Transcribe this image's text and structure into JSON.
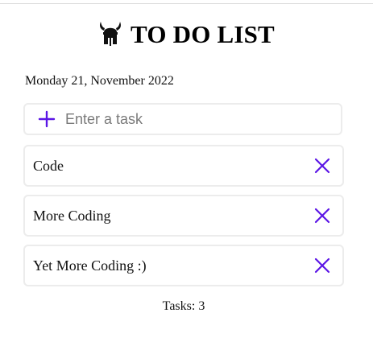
{
  "header": {
    "title": "TO DO LIST",
    "logo_icon": "viking-helmet-icon"
  },
  "date_label": "Monday 21, November 2022",
  "task_input": {
    "placeholder": "Enter a task",
    "value": "",
    "add_icon": "plus-icon"
  },
  "tasks": [
    {
      "text": "Code",
      "delete_icon": "close-icon"
    },
    {
      "text": "More Coding",
      "delete_icon": "close-icon"
    },
    {
      "text": "Yet More Coding :)",
      "delete_icon": "close-icon"
    }
  ],
  "footer": {
    "tasks_count": "Tasks: 3"
  },
  "colors": {
    "accent": "#5b16e6",
    "border": "#ececec",
    "text": "#111111"
  }
}
